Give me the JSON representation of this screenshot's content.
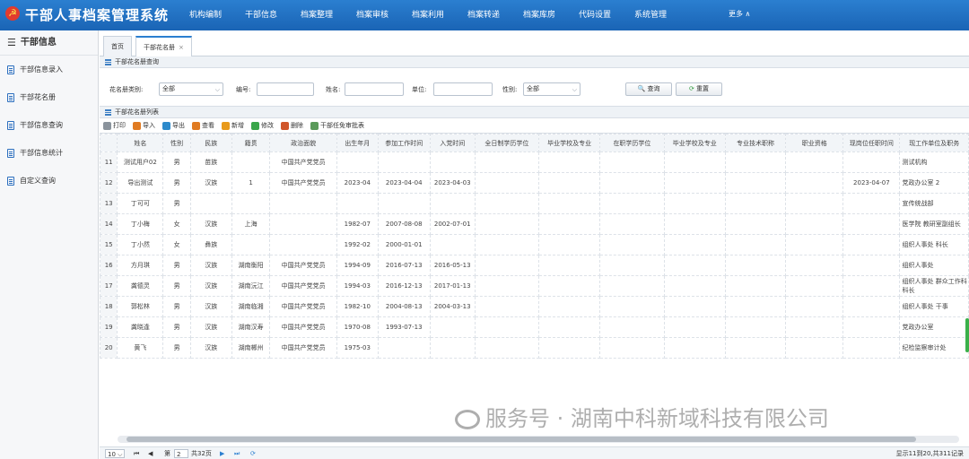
{
  "app": {
    "title": "干部人事档案管理系统",
    "more": "更多 ∧"
  },
  "nav": [
    "机构编制",
    "干部信息",
    "档案整理",
    "档案审核",
    "档案利用",
    "档案转递",
    "档案库房",
    "代码设置",
    "系统管理"
  ],
  "sidebar": {
    "title": "干部信息",
    "items": [
      "干部信息录入",
      "干部花名册",
      "干部信息查询",
      "干部信息统计",
      "自定义查询"
    ]
  },
  "tabs": [
    {
      "label": "首页"
    },
    {
      "label": "干部花名册",
      "close": "×"
    }
  ],
  "query": {
    "section_title": "干部花名册查询",
    "type_label": "花名册类别:",
    "type_value": "全部",
    "number_label": "编号:",
    "number_value": "",
    "name_label": "姓名:",
    "name_value": "",
    "unit_label": "单位:",
    "unit_value": "",
    "gender_label": "性别:",
    "gender_value": "全部",
    "query_button": "查询",
    "reset_button": "重置"
  },
  "list": {
    "section_title": "干部花名册列表",
    "toolbar": [
      "打印",
      "导入",
      "导出",
      "查看",
      "新增",
      "修改",
      "删除",
      "干部任免审批表"
    ]
  },
  "table": {
    "headers": [
      "姓名",
      "性别",
      "民族",
      "籍贯",
      "政治面貌",
      "出生年月",
      "参加工作时间",
      "入党时间",
      "全日制学历学位",
      "毕业学校及专业",
      "在职学历学位",
      "毕业学校及专业",
      "专业技术职称",
      "职业资格",
      "现岗位任职时间",
      "现工作单位及职务"
    ],
    "rows": [
      {
        "n": "11",
        "c": [
          "测试用户02",
          "男",
          "苗族",
          "",
          "中国共产党党员",
          "",
          "",
          "",
          "",
          "",
          "",
          "",
          "",
          "",
          "",
          "测试机构"
        ]
      },
      {
        "n": "12",
        "c": [
          "导出测试",
          "男",
          "汉族",
          "1",
          "中国共产党党员",
          "2023-04",
          "2023-04-04",
          "2023-04-03",
          "",
          "",
          "",
          "",
          "",
          "",
          "2023-04-07",
          "党政办公室 2"
        ]
      },
      {
        "n": "13",
        "c": [
          "丁可可",
          "男",
          "",
          "",
          "",
          "",
          "",
          "",
          "",
          "",
          "",
          "",
          "",
          "",
          "",
          "宣传统战部"
        ]
      },
      {
        "n": "14",
        "c": [
          "丁小梅",
          "女",
          "汉族",
          "上海",
          "",
          "1982-07",
          "2007-08-08",
          "2002-07-01",
          "",
          "",
          "",
          "",
          "",
          "",
          "",
          "医学院 教研室副组长"
        ]
      },
      {
        "n": "15",
        "c": [
          "丁小然",
          "女",
          "彝族",
          "",
          "",
          "1992-02",
          "2000-01-01",
          "",
          "",
          "",
          "",
          "",
          "",
          "",
          "",
          "组织人事处 科长"
        ]
      },
      {
        "n": "16",
        "c": [
          "方月琪",
          "男",
          "汉族",
          "湖南衡阳",
          "中国共产党党员",
          "1994-09",
          "2016-07-13",
          "2016-05-13",
          "",
          "",
          "",
          "",
          "",
          "",
          "",
          "组织人事处"
        ]
      },
      {
        "n": "17",
        "c": [
          "龚德灵",
          "男",
          "汉族",
          "湖南沅江",
          "中国共产党党员",
          "1994-03",
          "2016-12-13",
          "2017-01-13",
          "",
          "",
          "",
          "",
          "",
          "",
          "",
          "组织人事处 群众工作科科长"
        ]
      },
      {
        "n": "18",
        "c": [
          "郭松林",
          "男",
          "汉族",
          "湖南临湘",
          "中国共产党党员",
          "1982-10",
          "2004-08-13",
          "2004-03-13",
          "",
          "",
          "",
          "",
          "",
          "",
          "",
          "组织人事处 干事"
        ]
      },
      {
        "n": "19",
        "c": [
          "龚晓逢",
          "男",
          "汉族",
          "湖南汉寿",
          "中国共产党党员",
          "1970-08",
          "1993-07-13",
          "",
          "",
          "",
          "",
          "",
          "",
          "",
          "",
          "党政办公室"
        ]
      },
      {
        "n": "20",
        "c": [
          "黄飞",
          "男",
          "汉族",
          "湖南郴州",
          "中国共产党党员",
          "1975-03",
          "",
          "",
          "",
          "",
          "",
          "",
          "",
          "",
          "",
          "纪检监察审计处"
        ]
      }
    ]
  },
  "pager": {
    "size": "10",
    "page_prefix": "第",
    "page": "2",
    "page_total": "共32页",
    "summary": "显示11到20,共311记录"
  },
  "watermark": "服务号 · 湖南中科新域科技有限公司",
  "colors": {
    "topbar": "#1f6fc2",
    "accent": "#2b7fd0"
  }
}
